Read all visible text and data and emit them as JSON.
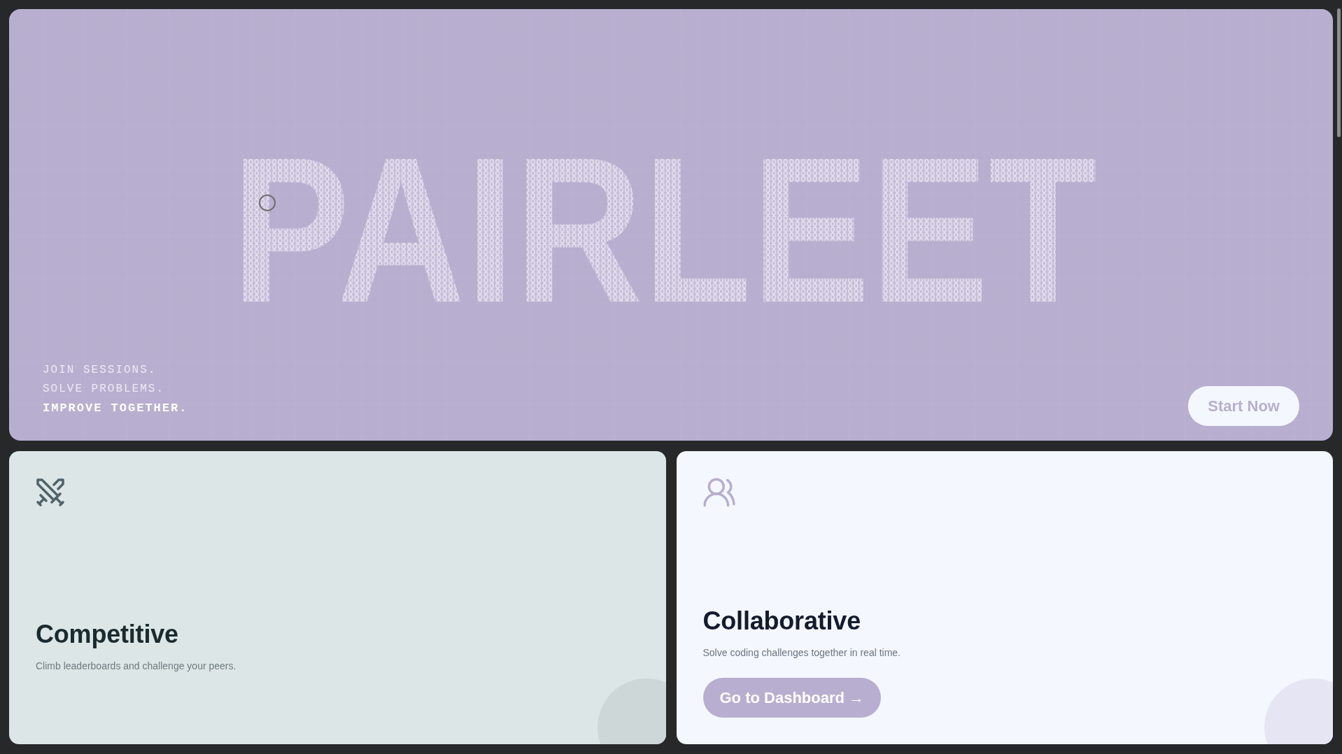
{
  "hero": {
    "logo": "PAIRLEET",
    "tagline": [
      {
        "text": "JOIN SESSIONS.",
        "emphasized": false
      },
      {
        "text": "SOLVE PROBLEMS.",
        "emphasized": false
      },
      {
        "text": "IMPROVE TOGETHER.",
        "emphasized": true
      }
    ],
    "button": "Start Now"
  },
  "competitive_card": {
    "title": "Competitive",
    "description": "Climb leaderboards and challenge your peers."
  },
  "collaborative_card": {
    "title": "Collaborative",
    "description": "Solve coding challenges together in real time.",
    "button": "Go to Dashboard →"
  }
}
